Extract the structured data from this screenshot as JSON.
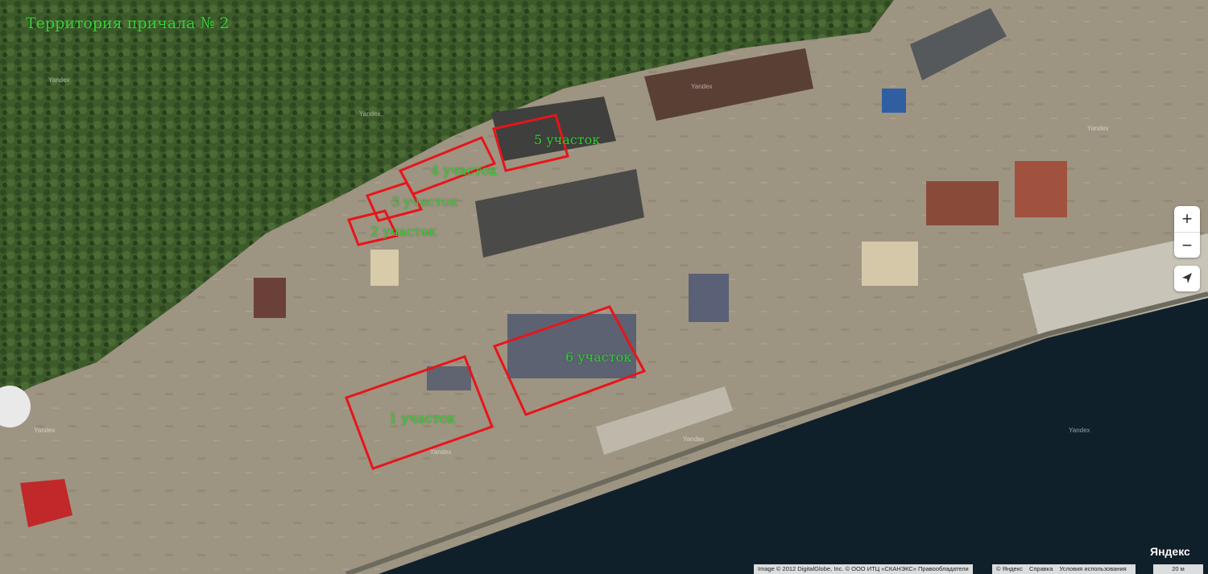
{
  "map": {
    "title": "Территория причала № 2",
    "plots": [
      {
        "id": "plot-1",
        "label": "1 участок"
      },
      {
        "id": "plot-2",
        "label": "2 участок"
      },
      {
        "id": "plot-3",
        "label": "3 участок"
      },
      {
        "id": "plot-4",
        "label": "4 участок"
      },
      {
        "id": "plot-5",
        "label": "5 участок"
      },
      {
        "id": "plot-6",
        "label": "6 участок"
      }
    ],
    "outline_color": "#e8141a",
    "label_color": "#2fcf2f",
    "watermark": "Yandex"
  },
  "controls": {
    "zoom_in": "+",
    "zoom_out": "−",
    "geolocation_icon": "location-arrow-icon"
  },
  "footer": {
    "logo": "Яндекс",
    "copyright": "Image © 2012 DigitalGlobe, Inc. © ООО ИТЦ «СКАНЭКС»",
    "rights_holders": "Правообладатели",
    "yandex_copy": "© Яндекс",
    "help": "Справка",
    "terms": "Условия использования",
    "scale": "20 м"
  }
}
